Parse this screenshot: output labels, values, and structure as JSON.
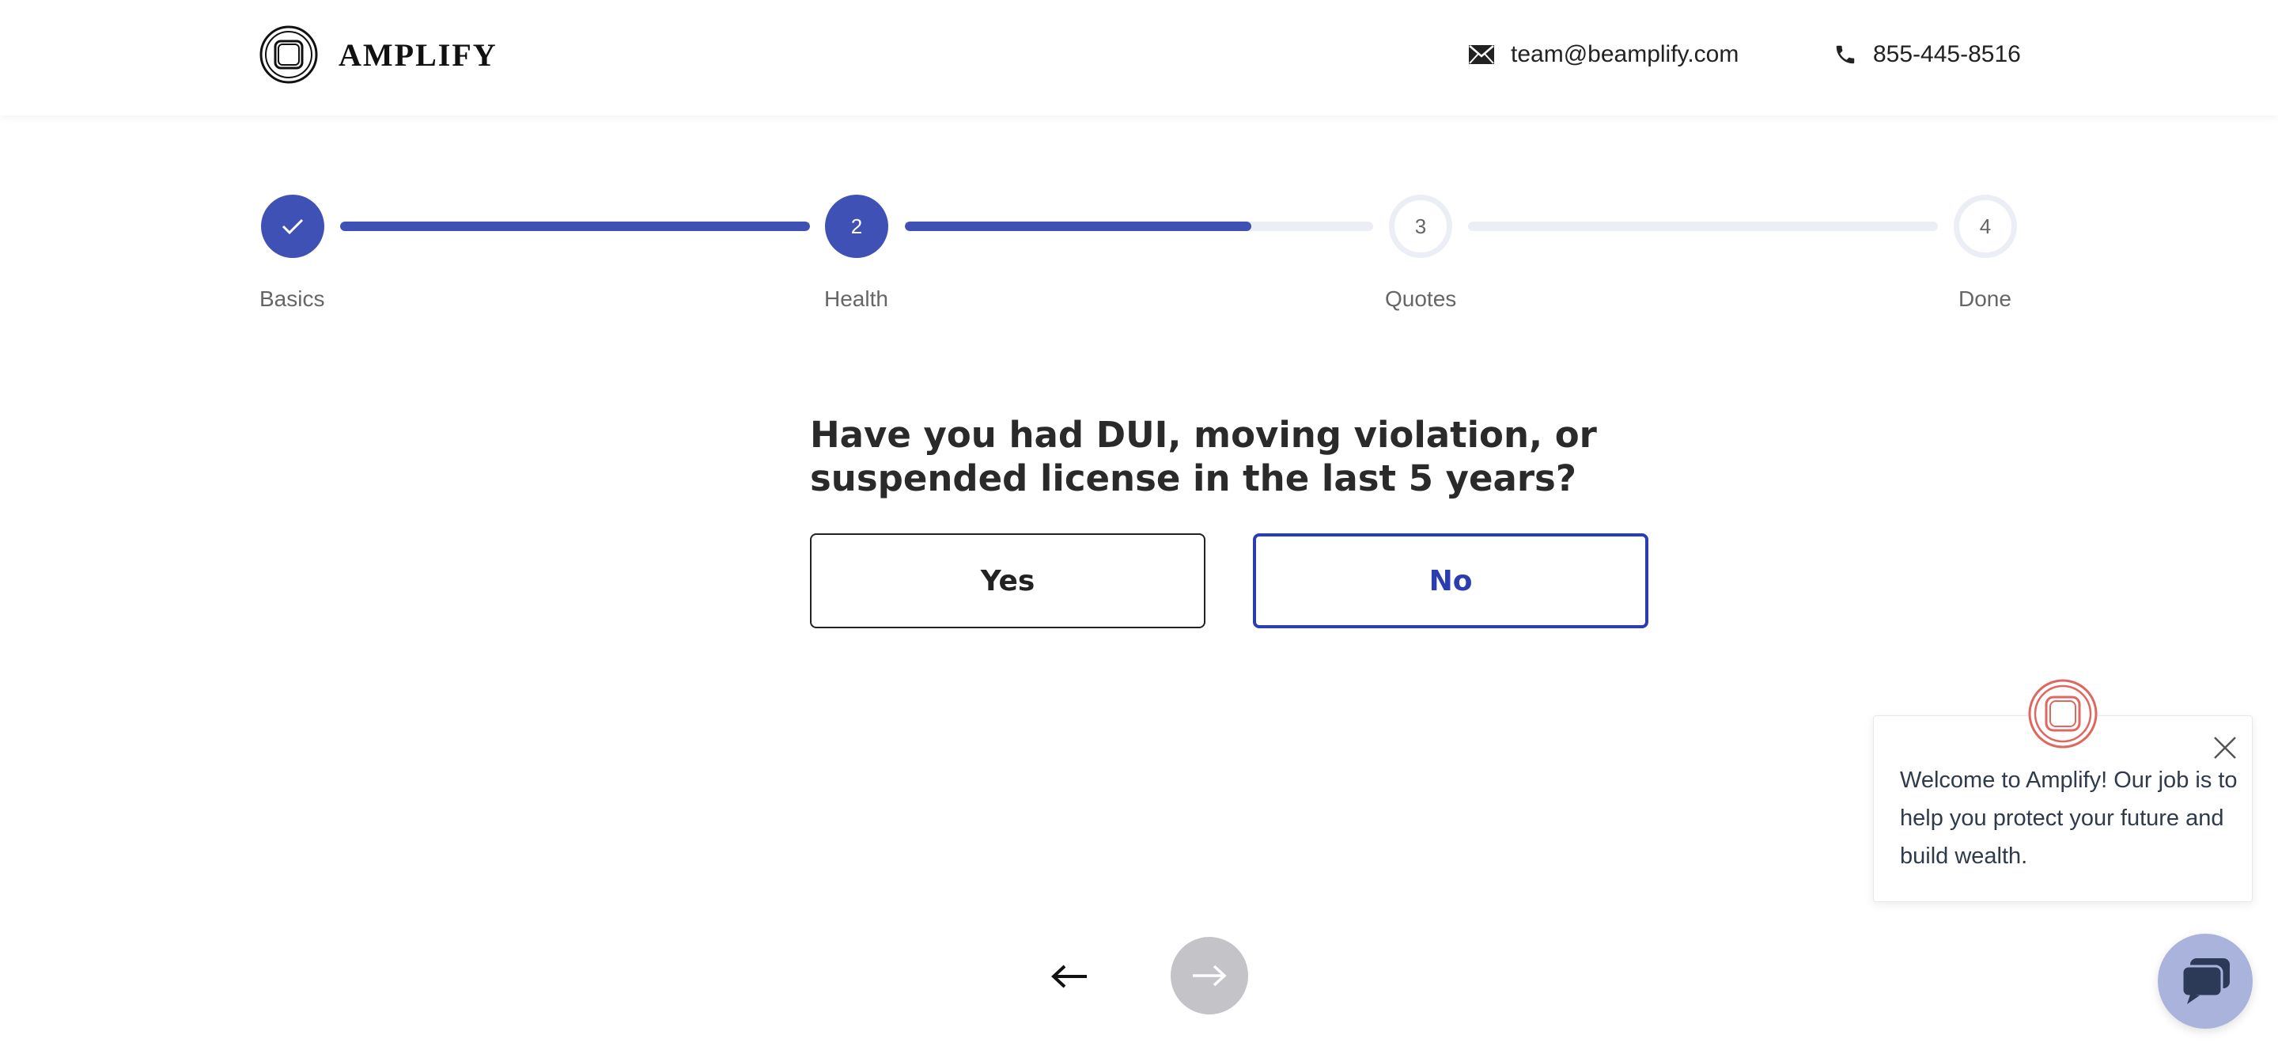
{
  "header": {
    "brand": "AMPLIFY",
    "email": "team@beamplify.com",
    "phone": "855-445-8516"
  },
  "stepper": {
    "steps": [
      {
        "number": "",
        "label": "Basics",
        "state": "done"
      },
      {
        "number": "2",
        "label": "Health",
        "state": "active"
      },
      {
        "number": "3",
        "label": "Quotes",
        "state": "pending"
      },
      {
        "number": "4",
        "label": "Done",
        "state": "pending"
      }
    ],
    "progress": [
      1.0,
      0.74,
      0.0
    ]
  },
  "question": {
    "text": "Have you had DUI, moving violation, or suspended license in the last 5 years?",
    "options": [
      "Yes",
      "No"
    ],
    "selected": "No"
  },
  "chat": {
    "message": "Welcome to Amplify! Our job is to help you protect your future and build wealth."
  },
  "colors": {
    "primary": "#3f51b5",
    "selected_border": "#2a3eb1",
    "track": "#eceef5",
    "next_disabled": "#c4c4c8",
    "chat_accent": "#aab3dc",
    "chat_logo": "#e0665f"
  },
  "icons": {
    "logo": "amplify-logo-icon",
    "email": "envelope-icon",
    "phone": "phone-icon",
    "done": "check-icon",
    "back": "arrow-left-icon",
    "next": "arrow-right-icon",
    "close": "close-icon",
    "chat": "chat-bubble-icon"
  }
}
